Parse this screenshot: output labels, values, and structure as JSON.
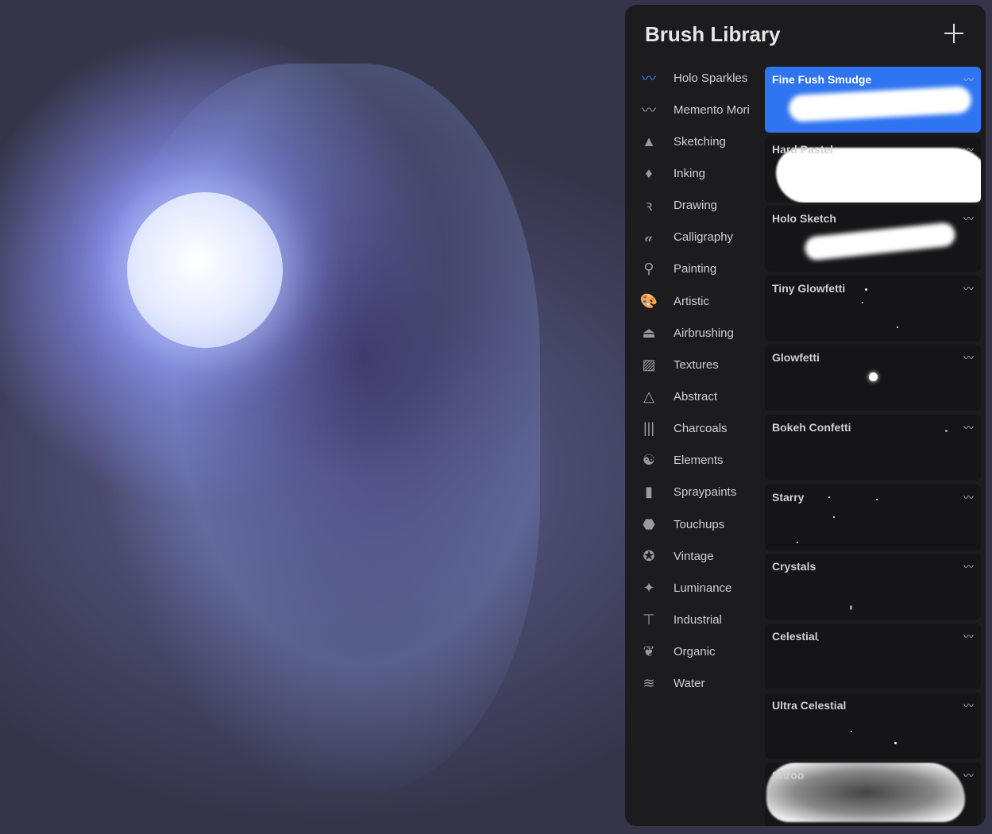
{
  "panel": {
    "title": "Brush Library",
    "add_icon": "plus-icon"
  },
  "categories": [
    {
      "label": "Holo Sparkles",
      "icon": "brush-stroke-icon",
      "glyph": "〰",
      "color": "#3a7cf5"
    },
    {
      "label": "Memento Mori",
      "icon": "brush-stroke-icon",
      "glyph": "〰"
    },
    {
      "label": "Sketching",
      "icon": "pencil-tip-icon",
      "glyph": "▲"
    },
    {
      "label": "Inking",
      "icon": "pen-nib-icon",
      "glyph": "♦"
    },
    {
      "label": "Drawing",
      "icon": "squiggle-icon",
      "glyph": "ꝛ"
    },
    {
      "label": "Calligraphy",
      "icon": "calligraphy-a-icon",
      "glyph": "𝒶"
    },
    {
      "label": "Painting",
      "icon": "paint-brush-icon",
      "glyph": "⚲"
    },
    {
      "label": "Artistic",
      "icon": "palette-icon",
      "glyph": "🎨"
    },
    {
      "label": "Airbrushing",
      "icon": "airbrush-icon",
      "glyph": "⏏"
    },
    {
      "label": "Textures",
      "icon": "texture-icon",
      "glyph": "▨"
    },
    {
      "label": "Abstract",
      "icon": "triangle-icon",
      "glyph": "△"
    },
    {
      "label": "Charcoals",
      "icon": "charcoal-icon",
      "glyph": "|||"
    },
    {
      "label": "Elements",
      "icon": "yin-yang-icon",
      "glyph": "☯"
    },
    {
      "label": "Spraypaints",
      "icon": "spray-can-icon",
      "glyph": "▮"
    },
    {
      "label": "Touchups",
      "icon": "touchup-icon",
      "glyph": "⬣"
    },
    {
      "label": "Vintage",
      "icon": "star-circle-icon",
      "glyph": "✪"
    },
    {
      "label": "Luminance",
      "icon": "sparkle-icon",
      "glyph": "✦"
    },
    {
      "label": "Industrial",
      "icon": "anvil-icon",
      "glyph": "⊤"
    },
    {
      "label": "Organic",
      "icon": "leaf-icon",
      "glyph": "❦"
    },
    {
      "label": "Water",
      "icon": "waves-icon",
      "glyph": "≋"
    }
  ],
  "brushes": [
    {
      "name": "Fine Fush Smudge",
      "selected": true
    },
    {
      "name": "Hard Pastel"
    },
    {
      "name": "Holo Sketch"
    },
    {
      "name": "Tiny Glowfetti"
    },
    {
      "name": "Glowfetti"
    },
    {
      "name": "Bokeh Confetti"
    },
    {
      "name": "Starry"
    },
    {
      "name": "Crystals"
    },
    {
      "name": "Celestial"
    },
    {
      "name": "Ultra Celestial"
    },
    {
      "name": "Shroo"
    }
  ],
  "brush_flag_icon": "brush-stroke-icon"
}
